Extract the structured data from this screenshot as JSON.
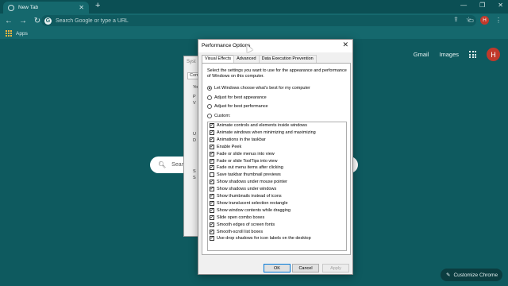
{
  "browser": {
    "tab": {
      "title": "New Tab"
    },
    "new_tab_symbol": "+",
    "omnibox": {
      "placeholder": "Search Google or type a URL"
    },
    "bookmarks": {
      "apps_label": "Apps"
    },
    "avatar_initial": "H"
  },
  "new_tab_page": {
    "links": {
      "gmail": "Gmail",
      "images": "Images"
    },
    "avatar_initial": "H",
    "search_text": "Search",
    "customize_label": "Customize Chrome"
  },
  "system_properties": {
    "title": "Syst",
    "tab_label": "Comp",
    "text_fragments": [
      "Yo",
      "P",
      "V",
      "U",
      "D",
      "S",
      "S"
    ]
  },
  "dialog": {
    "title": "Performance Options",
    "close_symbol": "✕",
    "tabs": [
      {
        "label": "Visual Effects",
        "active": true
      },
      {
        "label": "Advanced",
        "active": false
      },
      {
        "label": "Data Execution Prevention",
        "active": false
      }
    ],
    "description": "Select the settings you want to use for the appearance and performance of Windows on this computer.",
    "radios": [
      {
        "label": "Let Windows choose what's best for my computer",
        "selected": true
      },
      {
        "label": "Adjust for best appearance",
        "selected": false
      },
      {
        "label": "Adjust for best performance",
        "selected": false
      },
      {
        "label": "Custom:",
        "selected": false
      }
    ],
    "options": [
      {
        "label": "Animate controls and elements inside windows",
        "checked": true
      },
      {
        "label": "Animate windows when minimizing and maximizing",
        "checked": true
      },
      {
        "label": "Animations in the taskbar",
        "checked": true
      },
      {
        "label": "Enable Peek",
        "checked": true
      },
      {
        "label": "Fade or slide menus into view",
        "checked": true
      },
      {
        "label": "Fade or slide ToolTips into view",
        "checked": true
      },
      {
        "label": "Fade out menu items after clicking",
        "checked": true
      },
      {
        "label": "Save taskbar thumbnail previews",
        "checked": false
      },
      {
        "label": "Show shadows under mouse pointer",
        "checked": true
      },
      {
        "label": "Show shadows under windows",
        "checked": true
      },
      {
        "label": "Show thumbnails instead of icons",
        "checked": true
      },
      {
        "label": "Show translucent selection rectangle",
        "checked": true
      },
      {
        "label": "Show window contents while dragging",
        "checked": true
      },
      {
        "label": "Slide open combo boxes",
        "checked": true
      },
      {
        "label": "Smooth edges of screen fonts",
        "checked": true
      },
      {
        "label": "Smooth-scroll list boxes",
        "checked": true
      },
      {
        "label": "Use drop shadows for icon labels on the desktop",
        "checked": true
      }
    ],
    "buttons": {
      "ok": "OK",
      "cancel": "Cancel",
      "apply": "Apply"
    }
  }
}
